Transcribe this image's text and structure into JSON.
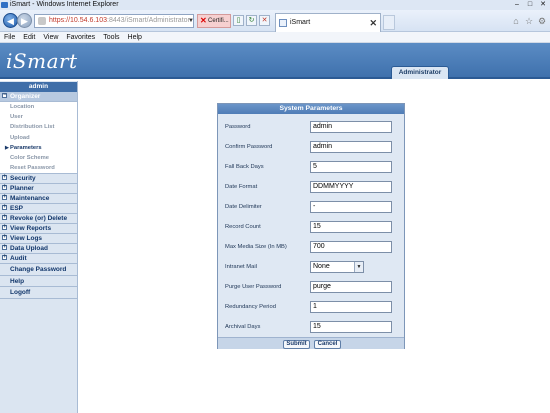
{
  "browser": {
    "window_title": "iSmart - Windows Internet Explorer",
    "address_host": "https://10.54.6.103",
    "address_path": ":8443/iSmart/Administrator",
    "cert_label": "Certifi...",
    "tab_title": "iSmart",
    "menu": [
      "File",
      "Edit",
      "View",
      "Favorites",
      "Tools",
      "Help"
    ]
  },
  "app": {
    "logo": "iSmart",
    "role_tab": "Administrator"
  },
  "sidebar": {
    "user": "admin",
    "organizer_label": "Organizer",
    "organizer_items": [
      {
        "label": "Location"
      },
      {
        "label": "User"
      },
      {
        "label": "Distribution List"
      },
      {
        "label": "Upload"
      },
      {
        "label": "Parameters"
      },
      {
        "label": "Color Scheme"
      },
      {
        "label": "Reset Password"
      }
    ],
    "sections": [
      {
        "label": "Security"
      },
      {
        "label": "Planner"
      },
      {
        "label": "Maintenance"
      },
      {
        "label": "ESP"
      },
      {
        "label": "Revoke (or) Delete"
      },
      {
        "label": "View Reports"
      },
      {
        "label": "View Logs"
      },
      {
        "label": "Data Upload"
      },
      {
        "label": "Audit"
      }
    ],
    "links": [
      {
        "label": "Change Password"
      },
      {
        "label": "Help"
      },
      {
        "label": "Logoff"
      }
    ]
  },
  "form": {
    "title": "System Parameters",
    "fields": [
      {
        "label": "Password",
        "value": "admin"
      },
      {
        "label": "Confirm Password",
        "value": "admin"
      },
      {
        "label": "Fall Back Days",
        "value": "5"
      },
      {
        "label": "Date Format",
        "value": "DDMMYYYY"
      },
      {
        "label": "Date Delimiter",
        "value": "-"
      },
      {
        "label": "Record Count",
        "value": "15"
      },
      {
        "label": "Max Media Size (In MB)",
        "value": "700"
      },
      {
        "label": "Intranet Mail",
        "value": "None"
      },
      {
        "label": "Purge User Password",
        "value": "purge"
      },
      {
        "label": "Redundancy Period",
        "value": "1"
      },
      {
        "label": "Archival Days",
        "value": "15"
      }
    ],
    "submit_label": "Submit",
    "cancel_label": "Cancel"
  }
}
